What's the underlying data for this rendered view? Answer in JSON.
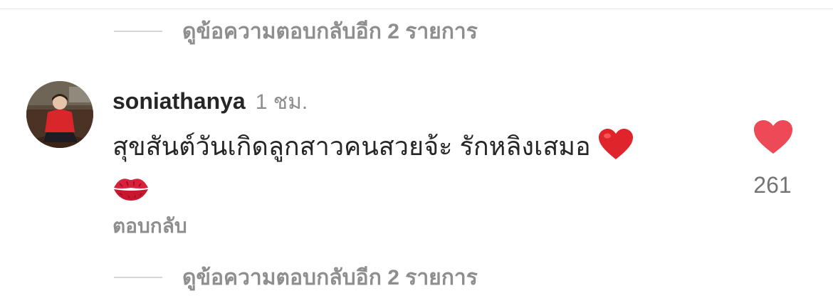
{
  "view_replies_top": {
    "label": "ดูข้อความตอบกลับอีก 2 รายการ"
  },
  "comment": {
    "username": "soniathanya",
    "time": "1 ชม.",
    "text": "สุขสันต์วันเกิดลูกสาวคนสวยจ้ะ รักหลิงเสมอ",
    "emojis": [
      "red-heart-emoji",
      "kiss-mark-emoji"
    ],
    "reply_label": "ตอบกลับ",
    "like_count": "261",
    "like_color": "#ed4956"
  },
  "view_replies_bottom": {
    "label": "ดูข้อความตอบกลับอีก 2 รายการ"
  }
}
